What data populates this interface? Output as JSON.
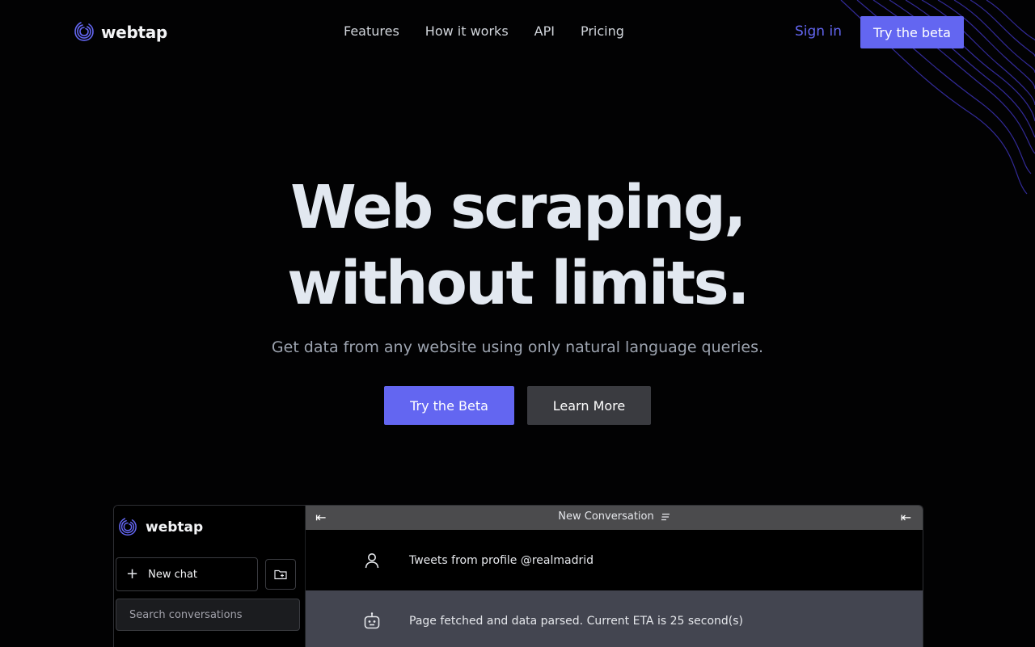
{
  "brand": {
    "name": "webtap"
  },
  "nav": {
    "links": [
      "Features",
      "How it works",
      "API",
      "Pricing"
    ],
    "sign_in": "Sign in",
    "cta": "Try the beta"
  },
  "hero": {
    "title_line1": "Web scraping,",
    "title_line2": "without limits.",
    "subtitle": "Get data from any website using only natural language queries.",
    "primary_cta": "Try the Beta",
    "secondary_cta": "Learn More"
  },
  "app_preview": {
    "brand_name": "webtap",
    "new_chat_label": "New chat",
    "search_placeholder": "Search conversations",
    "conversation_title": "New Conversation",
    "messages": [
      {
        "role": "user",
        "icon": "user-icon",
        "text": "Tweets from profile @realmadrid"
      },
      {
        "role": "assistant",
        "icon": "bot-icon",
        "text": "Page fetched and data parsed. Current ETA is 25 second(s)"
      }
    ]
  },
  "colors": {
    "accent": "#6366f1",
    "background": "#020203",
    "secondary_button": "#3a3b40",
    "preview_header": "#4b4b4d",
    "bot_message_bg": "#434550"
  }
}
